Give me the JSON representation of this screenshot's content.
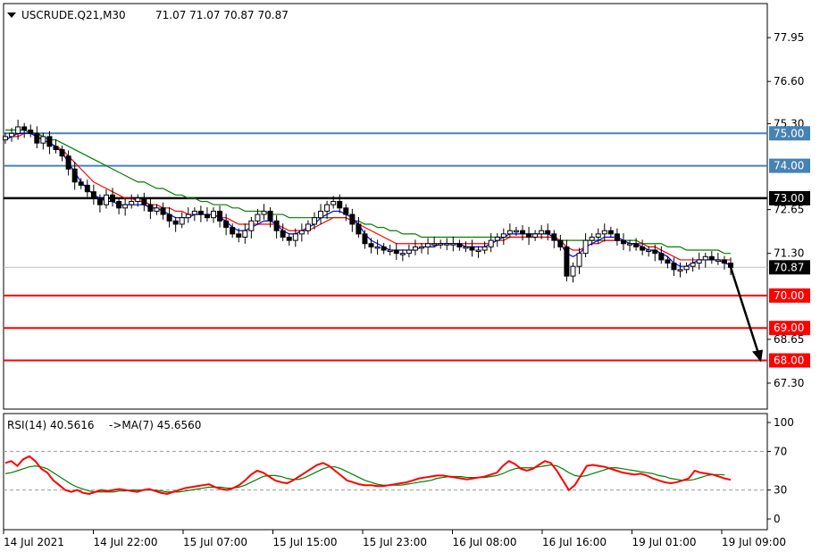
{
  "header": {
    "symbol": "USCRUDE.Q21,M30",
    "ohlc": "71.07 71.07 70.87 70.87"
  },
  "rsi_header": {
    "label": "RSI(14) 40.5616",
    "ma_label": "->MA(7) 45.6560"
  },
  "chart_data": [
    {
      "type": "candlestick",
      "price_ticks": [
        "77.95",
        "76.60",
        "75.30",
        "72.65",
        "71.30",
        "68.65",
        "67.30"
      ],
      "price_range": [
        66.5,
        79.0
      ],
      "current_price": 70.87,
      "current_price_label": "70.87",
      "levels": [
        {
          "label": "75.00",
          "value": 75.0,
          "color": "#4682b4"
        },
        {
          "label": "74.00",
          "value": 74.0,
          "color": "#4682b4"
        },
        {
          "label": "73.00",
          "value": 73.0,
          "color": "#000000"
        },
        {
          "label": "70.00",
          "value": 70.0,
          "color": "#ff0000"
        },
        {
          "label": "69.00",
          "value": 69.0,
          "color": "#ff0000"
        },
        {
          "label": "68.00",
          "value": 68.0,
          "color": "#ff0000"
        }
      ],
      "close_series": [
        74.9,
        75.0,
        75.2,
        75.1,
        75.0,
        74.7,
        74.9,
        74.6,
        74.5,
        74.3,
        73.9,
        73.5,
        73.4,
        73.2,
        73.0,
        72.8,
        73.1,
        72.9,
        72.7,
        72.8,
        72.9,
        73.0,
        72.8,
        72.6,
        72.7,
        72.5,
        72.3,
        72.2,
        72.4,
        72.5,
        72.6,
        72.5,
        72.4,
        72.6,
        72.3,
        72.1,
        71.9,
        71.8,
        72.0,
        72.3,
        72.5,
        72.6,
        72.3,
        72.0,
        71.8,
        71.7,
        71.9,
        72.0,
        72.2,
        72.4,
        72.6,
        72.8,
        72.9,
        72.7,
        72.5,
        72.2,
        71.9,
        71.6,
        71.5,
        71.5,
        71.4,
        71.4,
        71.3,
        71.3,
        71.4,
        71.5,
        71.5,
        71.6,
        71.6,
        71.6,
        71.6,
        71.6,
        71.5,
        71.5,
        71.4,
        71.4,
        71.5,
        71.7,
        71.8,
        71.9,
        72.0,
        72.0,
        71.9,
        71.8,
        71.9,
        72.0,
        71.9,
        71.7,
        71.5,
        70.6,
        70.9,
        71.3,
        71.7,
        71.8,
        71.9,
        72.0,
        71.9,
        71.7,
        71.6,
        71.6,
        71.5,
        71.4,
        71.4,
        71.3,
        71.1,
        71.0,
        70.8,
        70.8,
        70.9,
        71.0,
        71.1,
        71.2,
        71.1,
        71.1,
        71.0,
        70.87
      ],
      "ma_fast_series": [
        74.8,
        74.9,
        75.0,
        75.0,
        75.0,
        74.9,
        74.8,
        74.7,
        74.6,
        74.4,
        74.1,
        73.8,
        73.5,
        73.3,
        73.1,
        73.0,
        72.9,
        72.9,
        72.8,
        72.8,
        72.8,
        72.8,
        72.8,
        72.7,
        72.7,
        72.6,
        72.5,
        72.4,
        72.4,
        72.4,
        72.5,
        72.5,
        72.5,
        72.5,
        72.4,
        72.3,
        72.1,
        72.0,
        72.0,
        72.1,
        72.2,
        72.3,
        72.3,
        72.2,
        72.0,
        71.9,
        71.9,
        72.0,
        72.1,
        72.2,
        72.4,
        72.5,
        72.6,
        72.6,
        72.5,
        72.4,
        72.2,
        71.9,
        71.7,
        71.6,
        71.5,
        71.4,
        71.4,
        71.4,
        71.4,
        71.4,
        71.5,
        71.5,
        71.5,
        71.6,
        71.6,
        71.6,
        71.6,
        71.5,
        71.5,
        71.5,
        71.5,
        71.6,
        71.7,
        71.8,
        71.9,
        71.9,
        71.9,
        71.9,
        71.9,
        71.9,
        71.9,
        71.8,
        71.6,
        71.3,
        71.2,
        71.3,
        71.5,
        71.6,
        71.7,
        71.8,
        71.8,
        71.8,
        71.7,
        71.6,
        71.6,
        71.5,
        71.4,
        71.4,
        71.3,
        71.2,
        71.0,
        70.9,
        70.9,
        71.0,
        71.1,
        71.1,
        71.1,
        71.1,
        71.0,
        70.95
      ],
      "ma_mid_series": [
        74.8,
        74.9,
        74.9,
        75.0,
        75.0,
        74.9,
        74.8,
        74.7,
        74.6,
        74.5,
        74.3,
        74.1,
        73.9,
        73.7,
        73.5,
        73.4,
        73.3,
        73.2,
        73.1,
        73.0,
        73.0,
        72.9,
        72.9,
        72.8,
        72.8,
        72.7,
        72.7,
        72.6,
        72.6,
        72.5,
        72.5,
        72.5,
        72.5,
        72.5,
        72.4,
        72.4,
        72.3,
        72.2,
        72.2,
        72.2,
        72.2,
        72.2,
        72.2,
        72.2,
        72.1,
        72.0,
        72.0,
        72.0,
        72.0,
        72.1,
        72.2,
        72.3,
        72.4,
        72.4,
        72.4,
        72.3,
        72.2,
        72.1,
        72.0,
        71.9,
        71.8,
        71.7,
        71.6,
        71.6,
        71.6,
        71.6,
        71.6,
        71.6,
        71.6,
        71.6,
        71.6,
        71.6,
        71.6,
        71.6,
        71.6,
        71.6,
        71.6,
        71.6,
        71.7,
        71.7,
        71.8,
        71.8,
        71.8,
        71.8,
        71.8,
        71.8,
        71.8,
        71.8,
        71.7,
        71.5,
        71.4,
        71.4,
        71.5,
        71.6,
        71.6,
        71.7,
        71.7,
        71.7,
        71.7,
        71.6,
        71.6,
        71.6,
        71.5,
        71.5,
        71.4,
        71.3,
        71.2,
        71.1,
        71.1,
        71.1,
        71.1,
        71.1,
        71.1,
        71.1,
        71.1,
        71.1
      ],
      "ma_slow_series": [
        75.1,
        75.1,
        75.1,
        75.1,
        75.0,
        75.0,
        74.9,
        74.8,
        74.8,
        74.7,
        74.6,
        74.5,
        74.4,
        74.3,
        74.2,
        74.1,
        74.0,
        73.9,
        73.8,
        73.7,
        73.6,
        73.5,
        73.5,
        73.4,
        73.3,
        73.3,
        73.2,
        73.1,
        73.1,
        73.0,
        73.0,
        72.9,
        72.9,
        72.8,
        72.8,
        72.8,
        72.7,
        72.7,
        72.6,
        72.6,
        72.6,
        72.6,
        72.5,
        72.5,
        72.5,
        72.4,
        72.4,
        72.4,
        72.4,
        72.4,
        72.4,
        72.4,
        72.4,
        72.4,
        72.4,
        72.3,
        72.3,
        72.2,
        72.2,
        72.1,
        72.1,
        72.0,
        72.0,
        71.9,
        71.9,
        71.9,
        71.8,
        71.8,
        71.8,
        71.8,
        71.8,
        71.8,
        71.8,
        71.8,
        71.8,
        71.8,
        71.8,
        71.8,
        71.8,
        71.8,
        71.8,
        71.8,
        71.8,
        71.8,
        71.8,
        71.8,
        71.8,
        71.8,
        71.7,
        71.7,
        71.7,
        71.7,
        71.7,
        71.7,
        71.7,
        71.7,
        71.7,
        71.7,
        71.7,
        71.7,
        71.7,
        71.6,
        71.6,
        71.6,
        71.6,
        71.5,
        71.5,
        71.5,
        71.4,
        71.4,
        71.4,
        71.4,
        71.4,
        71.4,
        71.3,
        71.3
      ],
      "projection": {
        "from": 70.87,
        "to": 68.0
      },
      "colors": {
        "ma_fast": "#0000ff",
        "ma_mid": "#ff0000",
        "ma_slow": "#008000",
        "arrow": "#000000"
      }
    },
    {
      "type": "line",
      "title": "RSI(14)",
      "y_ticks": [
        "100",
        "70",
        "30",
        "0"
      ],
      "y_range": [
        0,
        100
      ],
      "dashed_levels": [
        70,
        30
      ],
      "rsi_series": [
        58,
        60,
        55,
        62,
        65,
        60,
        52,
        48,
        40,
        35,
        30,
        28,
        30,
        27,
        26,
        28,
        30,
        29,
        30,
        31,
        30,
        29,
        28,
        30,
        31,
        29,
        27,
        26,
        28,
        30,
        32,
        33,
        34,
        35,
        36,
        33,
        31,
        30,
        32,
        35,
        40,
        46,
        50,
        48,
        44,
        40,
        38,
        37,
        40,
        44,
        48,
        52,
        56,
        58,
        55,
        50,
        45,
        40,
        38,
        36,
        35,
        35,
        34,
        34,
        35,
        36,
        37,
        38,
        40,
        42,
        43,
        44,
        45,
        45,
        44,
        43,
        42,
        41,
        42,
        43,
        44,
        46,
        48,
        55,
        60,
        57,
        52,
        50,
        52,
        56,
        60,
        58,
        50,
        40,
        30,
        35,
        45,
        55,
        56,
        55,
        54,
        52,
        50,
        48,
        47,
        46,
        47,
        45,
        42,
        40,
        38,
        37,
        38,
        40,
        42,
        50,
        48,
        47,
        46,
        44,
        42,
        40.56
      ],
      "ma_series": [
        47,
        48,
        50,
        52,
        54,
        55,
        54,
        52,
        48,
        44,
        40,
        36,
        33,
        31,
        29,
        28,
        28,
        28,
        28,
        29,
        29,
        30,
        30,
        30,
        30,
        30,
        29,
        28,
        28,
        28,
        29,
        30,
        31,
        32,
        33,
        33,
        33,
        32,
        32,
        33,
        35,
        38,
        41,
        44,
        45,
        45,
        44,
        42,
        41,
        41,
        43,
        46,
        49,
        52,
        54,
        54,
        52,
        49,
        46,
        43,
        40,
        38,
        36,
        35,
        35,
        35,
        35,
        36,
        37,
        38,
        39,
        40,
        42,
        43,
        44,
        44,
        44,
        43,
        43,
        43,
        43,
        44,
        45,
        47,
        50,
        52,
        53,
        53,
        53,
        54,
        55,
        56,
        55,
        52,
        48,
        45,
        44,
        45,
        47,
        49,
        51,
        53,
        53,
        52,
        51,
        50,
        49,
        48,
        47,
        45,
        44,
        42,
        41,
        40,
        40,
        41,
        43,
        45,
        46,
        46,
        45.656
      ],
      "colors": {
        "rsi": "#ff0000",
        "ma": "#008000",
        "level": "#999999"
      }
    }
  ],
  "x_axis_labels": [
    "14 Jul 2021",
    "14 Jul 22:00",
    "15 Jul 07:00",
    "15 Jul 15:00",
    "15 Jul 23:00",
    "16 Jul 08:00",
    "16 Jul 16:00",
    "19 Jul 01:00",
    "19 Jul 09:00"
  ]
}
